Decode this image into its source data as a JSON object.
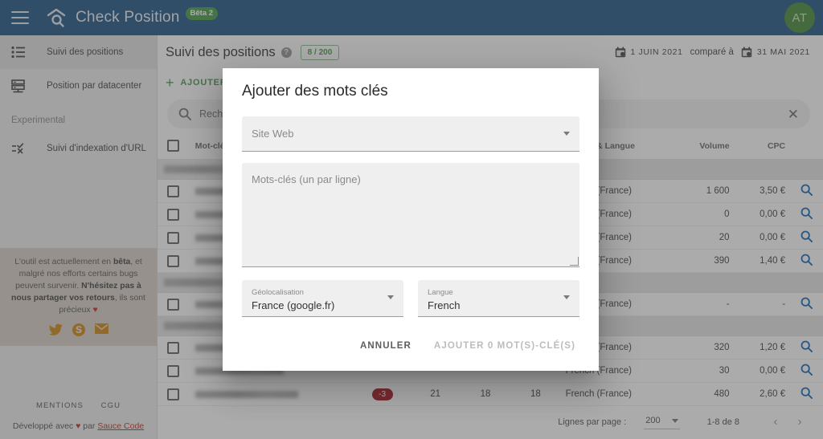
{
  "app": {
    "title": "Check Position",
    "beta_badge": "Bêta 2",
    "avatar_initials": "AT"
  },
  "sidebar": {
    "items": [
      {
        "label": "Suivi des positions",
        "icon": "list-icon",
        "active": true
      },
      {
        "label": "Position par datacenter",
        "icon": "server-icon",
        "active": false
      }
    ],
    "section_label": "Experimental",
    "experimental_items": [
      {
        "label": "Suivi d'indexation d'URL",
        "icon": "url-index-icon"
      }
    ],
    "beta_note": {
      "part1": "L'outil est actuellement en ",
      "bold1": "bêta",
      "part2": ", et malgré nos efforts certains bugs peuvent survenir. ",
      "bold2": "N'hésitez pas à nous partager vos retours",
      "part3": ", ils sont précieux ",
      "heart": "♥"
    },
    "social": [
      {
        "name": "twitter-icon"
      },
      {
        "name": "skype-icon"
      },
      {
        "name": "email-icon"
      }
    ],
    "footer_links": [
      "MENTIONS",
      "CGU"
    ],
    "made_by_prefix": "Développé avec ",
    "made_by_heart": "♥",
    "made_by_mid": " par ",
    "made_by_link": "Sauce Code"
  },
  "page": {
    "title": "Suivi des positions",
    "help_glyph": "?",
    "quota": "8 / 200",
    "add_button": "AJOUTER",
    "date_from": "1 JUIN 2021",
    "compare_label": "comparé à",
    "date_to": "31 MAI 2021"
  },
  "search": {
    "placeholder": "Rechercher",
    "value": "Rech",
    "clear_glyph": "✕"
  },
  "table": {
    "headers": {
      "keyword": "Mot-clé",
      "geoloc": "Géoloc & Langue",
      "volume": "Volume",
      "cpc": "CPC"
    },
    "rows": [
      {
        "type": "group"
      },
      {
        "type": "data",
        "geoloc": "French (France)",
        "volume": "1 600",
        "cpc": "3,50 €",
        "kw_w": 86
      },
      {
        "type": "data",
        "geoloc": "French (France)",
        "volume": "0",
        "cpc": "0,00 €",
        "kw_w": 104
      },
      {
        "type": "data",
        "geoloc": "French (France)",
        "volume": "20",
        "cpc": "0,00 €",
        "kw_w": 95
      },
      {
        "type": "data",
        "geoloc": "French (France)",
        "volume": "390",
        "cpc": "1,40 €",
        "kw_w": 72
      },
      {
        "type": "group"
      },
      {
        "type": "data",
        "geoloc": "French (France)",
        "volume": "-",
        "cpc": "-",
        "kw_w": 60
      },
      {
        "type": "group"
      },
      {
        "type": "data",
        "geoloc": "French (France)",
        "volume": "320",
        "cpc": "1,20 €",
        "kw_w": 90
      },
      {
        "type": "data",
        "geoloc": "French (France)",
        "volume": "30",
        "cpc": "0,00 €",
        "kw_w": 110
      },
      {
        "type": "data",
        "geoloc": "French (France)",
        "volume": "480",
        "cpc": "2,60 €",
        "kw_w": 128,
        "pos_delta": "-3",
        "pos_values": [
          "21",
          "18",
          "18"
        ]
      }
    ]
  },
  "paginator": {
    "rows_label": "Lignes par page :",
    "rows_value": "200",
    "range": "1-8 de 8",
    "prev_glyph": "‹",
    "next_glyph": "›"
  },
  "modal": {
    "title": "Ajouter des mots clés",
    "site_placeholder": "Site Web",
    "keywords_placeholder": "Mots-clés (un par ligne)",
    "geoloc_label": "Géolocalisation",
    "geoloc_value": "France (google.fr)",
    "lang_label": "Langue",
    "lang_value": "French",
    "cancel_label": "ANNULER",
    "submit_label": "AJOUTER 0 MOT(S)-CLÉ(S)"
  },
  "colors": {
    "topbar": "#2a5c8a",
    "accent_green": "#4c9e4c",
    "avatar": "#4c8c3e",
    "badge_red": "#a3202a",
    "link_blue": "#1a6bb5",
    "social_orange": "#cf8b1e"
  }
}
